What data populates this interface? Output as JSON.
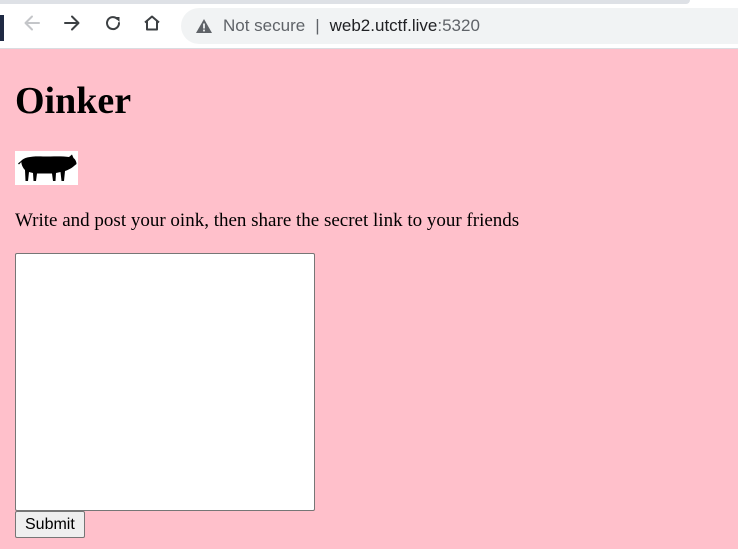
{
  "browser": {
    "security_label": "Not secure",
    "separator": "|",
    "url_host": "web2.utctf.live",
    "url_port": ":5320",
    "icons": [
      "back-arrow-icon",
      "forward-arrow-icon",
      "reload-icon",
      "home-icon",
      "warning-icon"
    ]
  },
  "page": {
    "heading": "Oinker",
    "image": "pig-silhouette",
    "instructions": "Write and post your oink, then share the secret link to your friends",
    "textarea_value": "",
    "submit_label": "Submit"
  },
  "colors": {
    "page_background": "#ffc0cb",
    "omnibox_background": "#f1f3f4"
  }
}
